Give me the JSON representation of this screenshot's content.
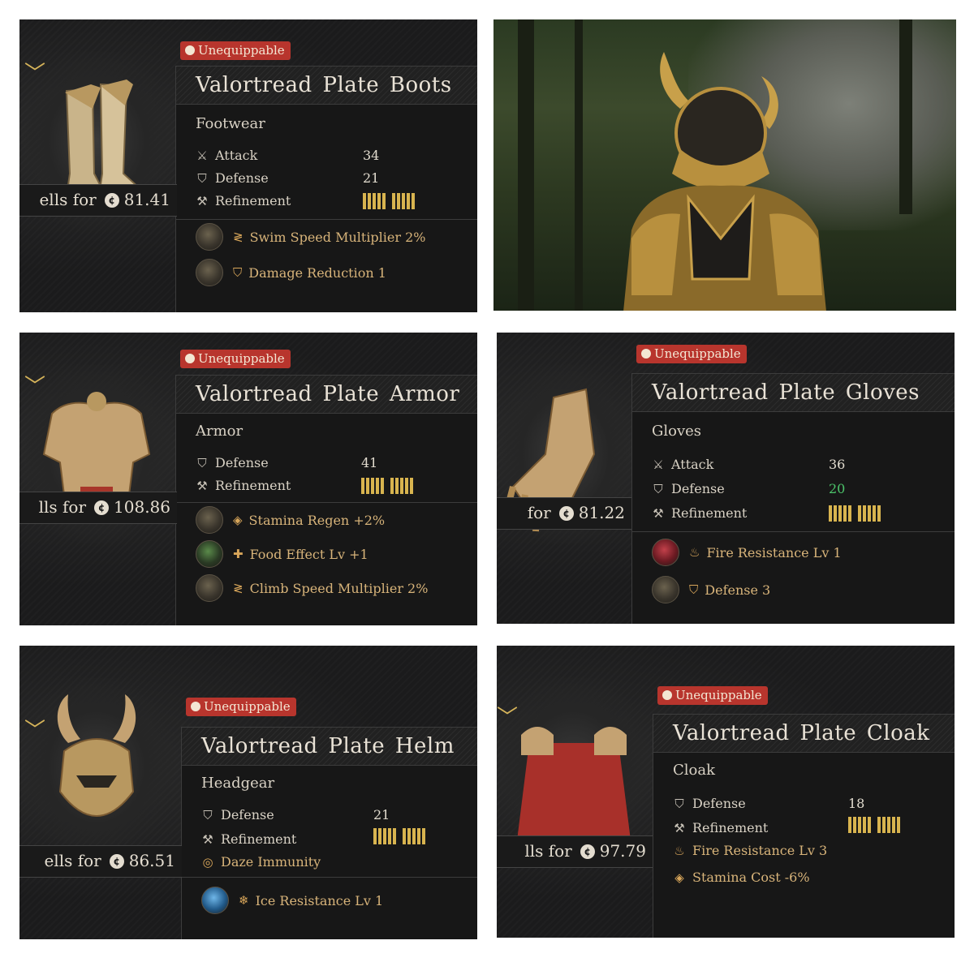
{
  "badge_label": "Unequippable",
  "sells_prefix": "ells for",
  "items": {
    "boots": {
      "name": "Valortread Plate Boots",
      "type": "Footwear",
      "sells_prefix": "ells for",
      "price": "81.41",
      "stats": [
        {
          "label": "Attack",
          "value": "34",
          "icon": "sword-icon"
        },
        {
          "label": "Defense",
          "value": "21",
          "icon": "shield-icon"
        },
        {
          "label": "Refinement",
          "icon": "anvil-icon"
        }
      ],
      "perks": [
        {
          "label": "Swim Speed Multiplier 2%",
          "icon": "speed-icon"
        },
        {
          "label": "Damage Reduction 1",
          "icon": "shield-icon"
        }
      ]
    },
    "armor": {
      "name": "Valortread Plate Armor",
      "type": "Armor",
      "sells_prefix": "lls for",
      "price": "108.86",
      "stats": [
        {
          "label": "Defense",
          "value": "41",
          "icon": "shield-icon"
        },
        {
          "label": "Refinement",
          "icon": "anvil-icon"
        }
      ],
      "perks": [
        {
          "label": "Stamina Regen +2%",
          "icon": "diamond-icon"
        },
        {
          "label": "Food Effect Lv +1",
          "icon": "cross-icon"
        },
        {
          "label": "Climb Speed Multiplier 2%",
          "icon": "speed-icon"
        }
      ]
    },
    "gloves": {
      "name": "Valortread Plate Gloves",
      "type": "Gloves",
      "sells_prefix": "for",
      "price": "81.22",
      "stats": [
        {
          "label": "Attack",
          "value": "36",
          "icon": "sword-icon"
        },
        {
          "label": "Defense",
          "value": "20",
          "icon": "shield-icon",
          "highlight": "#4cc46a"
        },
        {
          "label": "Refinement",
          "icon": "anvil-icon"
        }
      ],
      "perks": [
        {
          "label": "Fire Resistance Lv 1",
          "icon": "flame-icon"
        },
        {
          "label": "Defense 3",
          "icon": "shield-icon"
        }
      ]
    },
    "helm": {
      "name": "Valortread Plate Helm",
      "type": "Headgear",
      "sells_prefix": "ells for",
      "price": "86.51",
      "stats": [
        {
          "label": "Defense",
          "value": "21",
          "icon": "shield-icon"
        },
        {
          "label": "Refinement",
          "icon": "anvil-icon"
        },
        {
          "label": "Daze Immunity",
          "icon": "daze-icon"
        }
      ],
      "perks": [
        {
          "label": "Ice Resistance Lv 1",
          "icon": "snowflake-icon"
        }
      ]
    },
    "cloak": {
      "name": "Valortread Plate Cloak",
      "type": "Cloak",
      "sells_prefix": "lls for",
      "price": "97.79",
      "stats": [
        {
          "label": "Defense",
          "value": "18",
          "icon": "shield-icon"
        },
        {
          "label": "Refinement",
          "icon": "anvil-icon"
        },
        {
          "label": "Fire Resistance Lv 3",
          "icon": "flame-icon"
        },
        {
          "label": "Stamina Cost -6%",
          "icon": "diamond-icon"
        }
      ]
    }
  },
  "colors": {
    "panel_bg": "#1b1b1c",
    "badge_red": "#b8352d",
    "gold": "#d8b44f",
    "perk_text": "#d8b47a",
    "highlight_green": "#4cc46a"
  }
}
